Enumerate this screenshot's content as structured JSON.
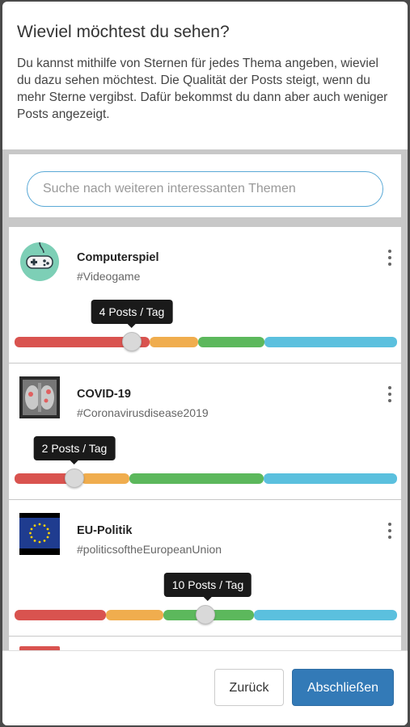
{
  "dialog": {
    "title": "Wieviel möchtest du sehen?",
    "description": "Du kannst mithilfe von Sternen für jedes Thema angeben, wieviel du dazu sehen möchtest. Die Qualität der Posts steigt, wenn du mehr Sterne vergibst. Dafür bekommst du dann aber auch weniger Posts angezeigt."
  },
  "search": {
    "placeholder": "Suche nach weiteren interessanten Themen"
  },
  "topics": [
    {
      "name": "Computerspiel",
      "tag": "#Videogame",
      "posts_label": "4 Posts / Tag",
      "level_fraction": 0.3,
      "image_icon": "gamepad-icon"
    },
    {
      "name": "COVID-19",
      "tag": "#Coronavirusdisease2019",
      "posts_label": "2 Posts / Tag",
      "level_fraction": 0.15,
      "image_icon": "lung-xray-icon"
    },
    {
      "name": "EU-Politik",
      "tag": "#politicsoftheEuropeanUnion",
      "posts_label": "10 Posts / Tag",
      "level_fraction": 0.5,
      "image_icon": "eu-flag-icon"
    }
  ],
  "footer": {
    "back_label": "Zurück",
    "finish_label": "Abschließen"
  },
  "colors": {
    "red": "#d9534f",
    "orange": "#f0ad4e",
    "green": "#5cb85c",
    "blue": "#5bc0de",
    "primary": "#337ab7"
  }
}
